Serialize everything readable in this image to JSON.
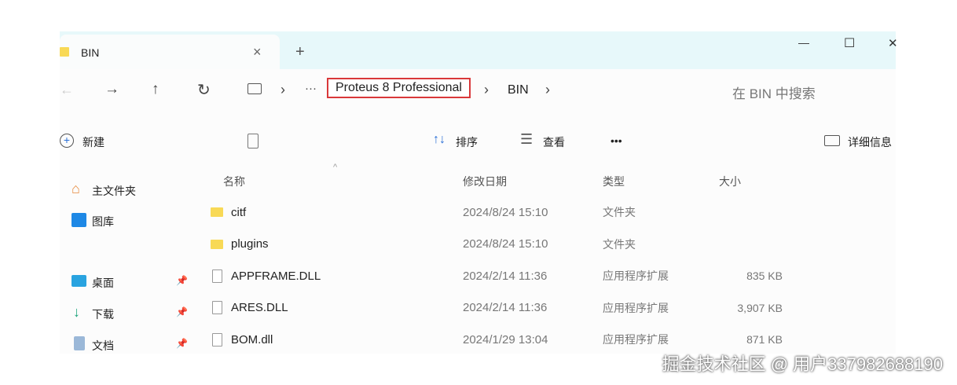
{
  "tab": {
    "title": "BIN",
    "close": "×",
    "new": "+"
  },
  "window": {
    "minimize": "—",
    "maximize": "☐",
    "close": "✕"
  },
  "nav": {
    "back": "←",
    "forward": "→",
    "up": "↑",
    "refresh": "↻",
    "sep": "›",
    "more": "···",
    "breadcrumb": [
      "Proteus 8 Professional",
      "BIN"
    ],
    "search_placeholder": "在 BIN 中搜索"
  },
  "toolbar": {
    "new": "新建",
    "sort": "排序",
    "view": "查看",
    "more": "•••",
    "details": "详细信息",
    "highlight": "#d9383a"
  },
  "sidebar": [
    {
      "label": "主文件夹",
      "icon": "home-icon"
    },
    {
      "label": "图库",
      "icon": "gallery-icon"
    },
    {
      "label": "桌面",
      "icon": "desktop-icon",
      "pinned": true
    },
    {
      "label": "下载",
      "icon": "download-icon",
      "pinned": true
    },
    {
      "label": "文档",
      "icon": "document-icon",
      "pinned": true
    }
  ],
  "columns": {
    "name": "名称",
    "date": "修改日期",
    "type": "类型",
    "size": "大小"
  },
  "files": [
    {
      "name": "citf",
      "date": "2024/8/24 15:10",
      "type": "文件夹",
      "size": "",
      "kind": "folder"
    },
    {
      "name": "plugins",
      "date": "2024/8/24 15:10",
      "type": "文件夹",
      "size": "",
      "kind": "folder"
    },
    {
      "name": "APPFRAME.DLL",
      "date": "2024/2/14 11:36",
      "type": "应用程序扩展",
      "size": "835 KB",
      "kind": "file"
    },
    {
      "name": "ARES.DLL",
      "date": "2024/2/14 11:36",
      "type": "应用程序扩展",
      "size": "3,907 KB",
      "kind": "file"
    },
    {
      "name": "BOM.dll",
      "date": "2024/1/29 13:04",
      "type": "应用程序扩展",
      "size": "871 KB",
      "kind": "file"
    }
  ],
  "watermark": "掘金技术社区 @ 用户337982688190"
}
